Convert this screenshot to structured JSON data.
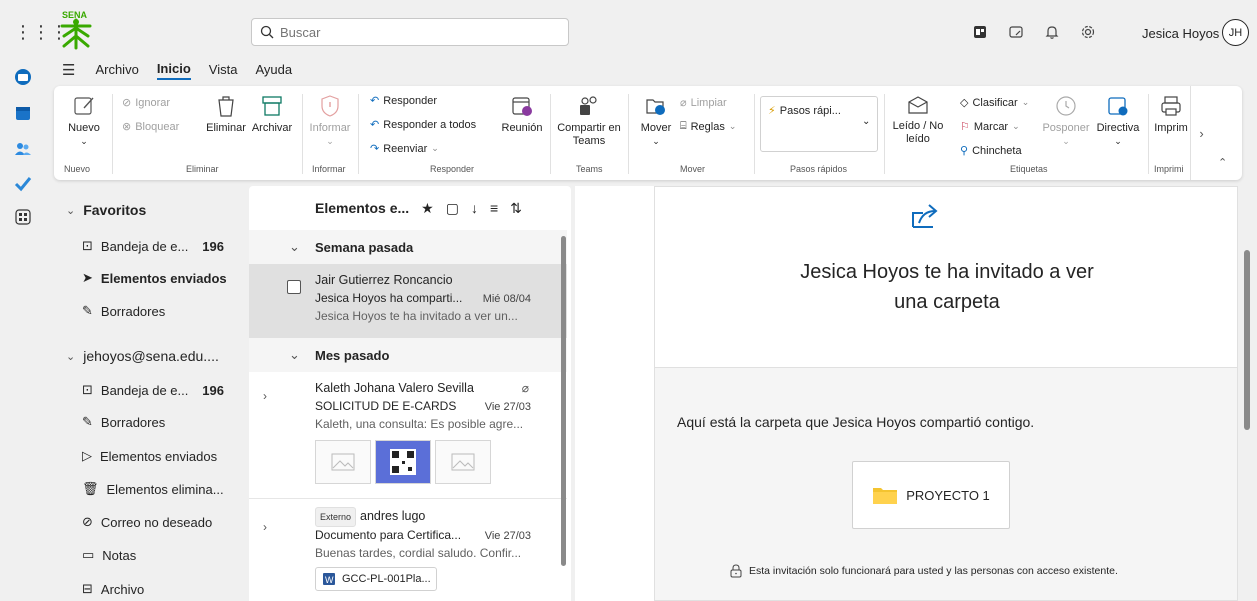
{
  "topbar": {
    "search_placeholder": "Buscar",
    "user_name": "Jesica Hoyos",
    "user_initials": "JH",
    "logo_text": "SENA",
    "icons": [
      "grid-icon",
      "whiteboard-icon",
      "feedback-icon",
      "bell-icon",
      "gear-icon"
    ]
  },
  "menu": {
    "tabs": [
      "Archivo",
      "Inicio",
      "Vista",
      "Ayuda"
    ],
    "active": "Inicio"
  },
  "ribbon": {
    "nuevo": {
      "label": "Nuevo",
      "group": "Nuevo"
    },
    "eliminar_group": {
      "ignorar": "Ignorar",
      "bloquear": "Bloquear",
      "eliminar": "Eliminar",
      "archivar": "Archivar",
      "group": "Eliminar"
    },
    "informar": {
      "label": "Informar",
      "group": "Informar"
    },
    "responder_group": {
      "responder": "Responder",
      "responder_todos": "Responder a todos",
      "reenviar": "Reenviar",
      "reunion": "Reunión",
      "group": "Responder"
    },
    "teams": {
      "label": "Compartir en Teams",
      "group": "Teams"
    },
    "mover_group": {
      "mover": "Mover",
      "limpiar": "Limpiar",
      "reglas": "Reglas",
      "group": "Mover"
    },
    "pasos_rapidos": {
      "label": "Pasos rápi...",
      "group": "Pasos rápidos"
    },
    "etiquetas_group": {
      "leido": "Leído / No leído",
      "clasificar": "Clasificar",
      "marcar": "Marcar",
      "chincheta": "Chincheta",
      "posponer": "Posponer",
      "directiva": "Directiva",
      "group": "Etiquetas"
    },
    "imprimir": {
      "label": "Imprim",
      "group": "Imprimi"
    }
  },
  "folders": {
    "favoritos_label": "Favoritos",
    "favoritos": [
      {
        "name": "Bandeja de e...",
        "count": "196"
      },
      {
        "name": "Elementos enviados",
        "count": ""
      },
      {
        "name": "Borradores",
        "count": ""
      }
    ],
    "account_label": "jehoyos@sena.edu....",
    "account": [
      {
        "name": "Bandeja de e...",
        "count": "196"
      },
      {
        "name": "Borradores",
        "count": ""
      },
      {
        "name": "Elementos enviados",
        "count": ""
      },
      {
        "name": "Elementos elimina...",
        "count": ""
      },
      {
        "name": "Correo no deseado",
        "count": ""
      },
      {
        "name": "Notas",
        "count": ""
      },
      {
        "name": "Archivo",
        "count": ""
      }
    ]
  },
  "msglist": {
    "title": "Elementos e...",
    "groups": [
      "Semana pasada",
      "Mes pasado"
    ],
    "messages": [
      {
        "sender": "Jair Gutierrez Roncancio",
        "subject": "Jesica Hoyos ha comparti...",
        "date": "Mié 08/04",
        "preview": "Jesica Hoyos te ha invitado a ver un..."
      },
      {
        "sender": "Kaleth Johana Valero Sevilla",
        "subject": "SOLICITUD DE E-CARDS",
        "date": "Vie 27/03",
        "preview": "Kaleth, una consulta: Es posible agre..."
      },
      {
        "badge": "Externo",
        "sender": "andres lugo",
        "subject": "Documento para Certifica...",
        "date": "Vie 27/03",
        "preview": "Buenas tardes, cordial saludo. Confir...",
        "attachment": "GCC-PL-001Pla..."
      }
    ]
  },
  "reading": {
    "title_line1": "Jesica Hoyos te ha invitado a ver",
    "title_line2": "una carpeta",
    "shared_text": "Aquí está la carpeta que Jesica Hoyos compartió contigo.",
    "folder_name": "PROYECTO 1",
    "note": "Esta invitación solo funcionará para usted y las personas con acceso existente."
  },
  "colors": {
    "accent": "#0f6cbd",
    "folder_yellow": "#f4c430",
    "sena_green": "#39a900"
  }
}
